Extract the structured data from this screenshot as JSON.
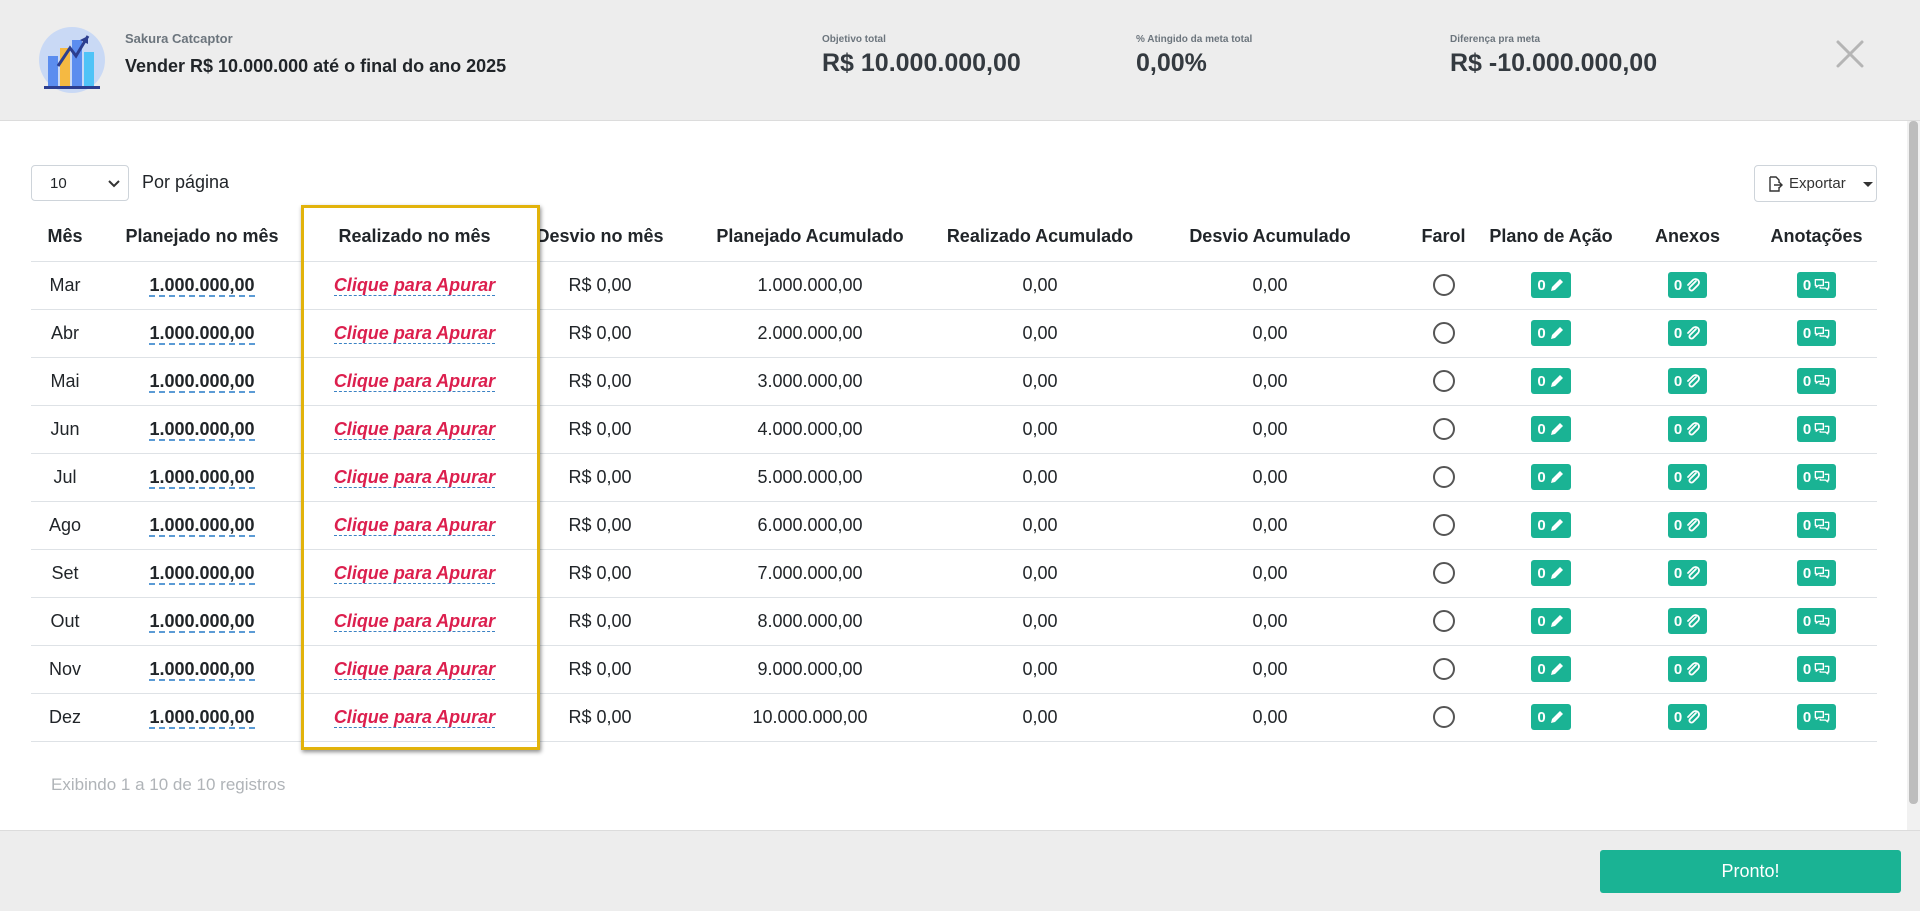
{
  "header": {
    "company": "Sakura Catcaptor",
    "goal_title": "Vender R$ 10.000.000 até o final do ano 2025",
    "stats": [
      {
        "label": "Objetivo total",
        "value": "R$ 10.000.000,00"
      },
      {
        "label": "% Atingido da meta total",
        "value": "0,00%"
      },
      {
        "label": "Diferença pra meta",
        "value": "R$ -10.000.000,00"
      }
    ]
  },
  "controls": {
    "per_page_value": "10",
    "per_page_label": "Por página",
    "export_label": "Exportar"
  },
  "table": {
    "columns": [
      "Mês",
      "Planejado no mês",
      "Realizado no mês",
      "Desvio no mês",
      "Planejado Acumulado",
      "Realizado Acumulado",
      "Desvio Acumulado",
      "Farol",
      "Plano de Ação",
      "Anexos",
      "Anotações"
    ],
    "rows": [
      {
        "mes": "Mar",
        "planejado": "1.000.000,00",
        "realizado": "Clique para Apurar",
        "desvio": "R$ 0,00",
        "plan_acum": "1.000.000,00",
        "real_acum": "0,00",
        "desv_acum": "0,00",
        "plano": "0",
        "anexos": "0",
        "anotacoes": "0"
      },
      {
        "mes": "Abr",
        "planejado": "1.000.000,00",
        "realizado": "Clique para Apurar",
        "desvio": "R$ 0,00",
        "plan_acum": "2.000.000,00",
        "real_acum": "0,00",
        "desv_acum": "0,00",
        "plano": "0",
        "anexos": "0",
        "anotacoes": "0"
      },
      {
        "mes": "Mai",
        "planejado": "1.000.000,00",
        "realizado": "Clique para Apurar",
        "desvio": "R$ 0,00",
        "plan_acum": "3.000.000,00",
        "real_acum": "0,00",
        "desv_acum": "0,00",
        "plano": "0",
        "anexos": "0",
        "anotacoes": "0"
      },
      {
        "mes": "Jun",
        "planejado": "1.000.000,00",
        "realizado": "Clique para Apurar",
        "desvio": "R$ 0,00",
        "plan_acum": "4.000.000,00",
        "real_acum": "0,00",
        "desv_acum": "0,00",
        "plano": "0",
        "anexos": "0",
        "anotacoes": "0"
      },
      {
        "mes": "Jul",
        "planejado": "1.000.000,00",
        "realizado": "Clique para Apurar",
        "desvio": "R$ 0,00",
        "plan_acum": "5.000.000,00",
        "real_acum": "0,00",
        "desv_acum": "0,00",
        "plano": "0",
        "anexos": "0",
        "anotacoes": "0"
      },
      {
        "mes": "Ago",
        "planejado": "1.000.000,00",
        "realizado": "Clique para Apurar",
        "desvio": "R$ 0,00",
        "plan_acum": "6.000.000,00",
        "real_acum": "0,00",
        "desv_acum": "0,00",
        "plano": "0",
        "anexos": "0",
        "anotacoes": "0"
      },
      {
        "mes": "Set",
        "planejado": "1.000.000,00",
        "realizado": "Clique para Apurar",
        "desvio": "R$ 0,00",
        "plan_acum": "7.000.000,00",
        "real_acum": "0,00",
        "desv_acum": "0,00",
        "plano": "0",
        "anexos": "0",
        "anotacoes": "0"
      },
      {
        "mes": "Out",
        "planejado": "1.000.000,00",
        "realizado": "Clique para Apurar",
        "desvio": "R$ 0,00",
        "plan_acum": "8.000.000,00",
        "real_acum": "0,00",
        "desv_acum": "0,00",
        "plano": "0",
        "anexos": "0",
        "anotacoes": "0"
      },
      {
        "mes": "Nov",
        "planejado": "1.000.000,00",
        "realizado": "Clique para Apurar",
        "desvio": "R$ 0,00",
        "plan_acum": "9.000.000,00",
        "real_acum": "0,00",
        "desv_acum": "0,00",
        "plano": "0",
        "anexos": "0",
        "anotacoes": "0"
      },
      {
        "mes": "Dez",
        "planejado": "1.000.000,00",
        "realizado": "Clique para Apurar",
        "desvio": "R$ 0,00",
        "plan_acum": "10.000.000,00",
        "real_acum": "0,00",
        "desv_acum": "0,00",
        "plano": "0",
        "anexos": "0",
        "anotacoes": "0"
      }
    ]
  },
  "info": "Exibindo 1 a 10 de 10 registros",
  "footer": {
    "done_label": "Pronto!"
  },
  "colors": {
    "accent": "#1ab394",
    "apurar": "#dc1f4e",
    "highlight": "#e2b30b"
  }
}
